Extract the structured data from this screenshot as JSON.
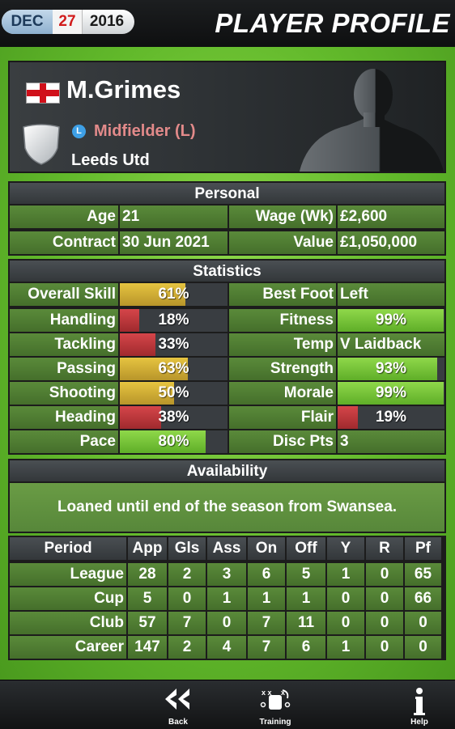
{
  "date": {
    "month": "DEC",
    "day": "27",
    "year": "2016"
  },
  "page_title": "PLAYER PROFILE",
  "player": {
    "name": "M.Grimes",
    "nationality_icon": "england-flag-icon",
    "position_badge": "L",
    "position": "Midfielder (L)",
    "club": "Leeds Utd"
  },
  "personal": {
    "title": "Personal",
    "age_label": "Age",
    "age": "21",
    "wage_label": "Wage (Wk)",
    "wage": "£2,600",
    "contract_label": "Contract",
    "contract": "30 Jun 2021",
    "value_label": "Value",
    "value": "£1,050,000"
  },
  "statistics": {
    "title": "Statistics",
    "left": [
      {
        "label": "Overall Skill",
        "value": "61%",
        "level": 0.61,
        "color": "yellow"
      },
      {
        "label": "Handling",
        "value": "18%",
        "level": 0.18,
        "color": "red"
      },
      {
        "label": "Tackling",
        "value": "33%",
        "level": 0.33,
        "color": "red"
      },
      {
        "label": "Passing",
        "value": "63%",
        "level": 0.63,
        "color": "yellow"
      },
      {
        "label": "Shooting",
        "value": "50%",
        "level": 0.5,
        "color": "yellow"
      },
      {
        "label": "Heading",
        "value": "38%",
        "level": 0.38,
        "color": "red"
      },
      {
        "label": "Pace",
        "value": "80%",
        "level": 0.8,
        "color": "green"
      }
    ],
    "right": [
      {
        "label": "Best Foot",
        "value": "Left"
      },
      {
        "label": "Fitness",
        "value": "99%",
        "level": 0.99,
        "color": "green"
      },
      {
        "label": "Temp",
        "value": "V Laidback"
      },
      {
        "label": "Strength",
        "value": "93%",
        "level": 0.93,
        "color": "green"
      },
      {
        "label": "Morale",
        "value": "99%",
        "level": 0.99,
        "color": "green"
      },
      {
        "label": "Flair",
        "value": "19%",
        "level": 0.19,
        "color": "red"
      },
      {
        "label": "Disc Pts",
        "value": "3"
      }
    ]
  },
  "availability": {
    "title": "Availability",
    "text": "Loaned until end of the season from Swansea."
  },
  "career": {
    "headers": [
      "Period",
      "App",
      "Gls",
      "Ass",
      "On",
      "Off",
      "Y",
      "R",
      "Pf"
    ],
    "rows": [
      [
        "League",
        "28",
        "2",
        "3",
        "6",
        "5",
        "1",
        "0",
        "65"
      ],
      [
        "Cup",
        "5",
        "0",
        "1",
        "1",
        "1",
        "0",
        "0",
        "66"
      ],
      [
        "Club",
        "57",
        "7",
        "0",
        "7",
        "11",
        "0",
        "0",
        "0"
      ],
      [
        "Career",
        "147",
        "2",
        "4",
        "7",
        "6",
        "1",
        "0",
        "0"
      ]
    ]
  },
  "nav": {
    "back": "Back",
    "training": "Training",
    "help": "Help"
  },
  "colors": {
    "field_green": "#62b92b",
    "bar_yellow": "#d4b237",
    "bar_red": "#c23a3f",
    "bar_green": "#7cc83a",
    "position_text": "#e28a8a"
  }
}
